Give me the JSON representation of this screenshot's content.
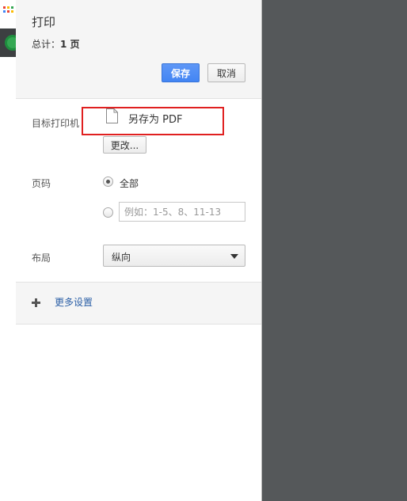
{
  "dialog": {
    "title": "打印",
    "summary_label": "总计：",
    "summary_value": "1 页"
  },
  "buttons": {
    "save": "保存",
    "cancel": "取消",
    "change": "更改..."
  },
  "destination": {
    "label": "目标打印机",
    "name": "另存为 PDF"
  },
  "pages": {
    "label": "页码",
    "all_option": "全部",
    "custom_placeholder": "例如：1-5、8、11-13",
    "custom_value": ""
  },
  "layout": {
    "label": "布局",
    "selected": "纵向"
  },
  "more_settings": {
    "label": "更多设置"
  },
  "colors": {
    "accent": "#4285f4",
    "highlight_border": "#e02020",
    "link": "#2b5fa6",
    "preview_bg": "#55585a"
  }
}
